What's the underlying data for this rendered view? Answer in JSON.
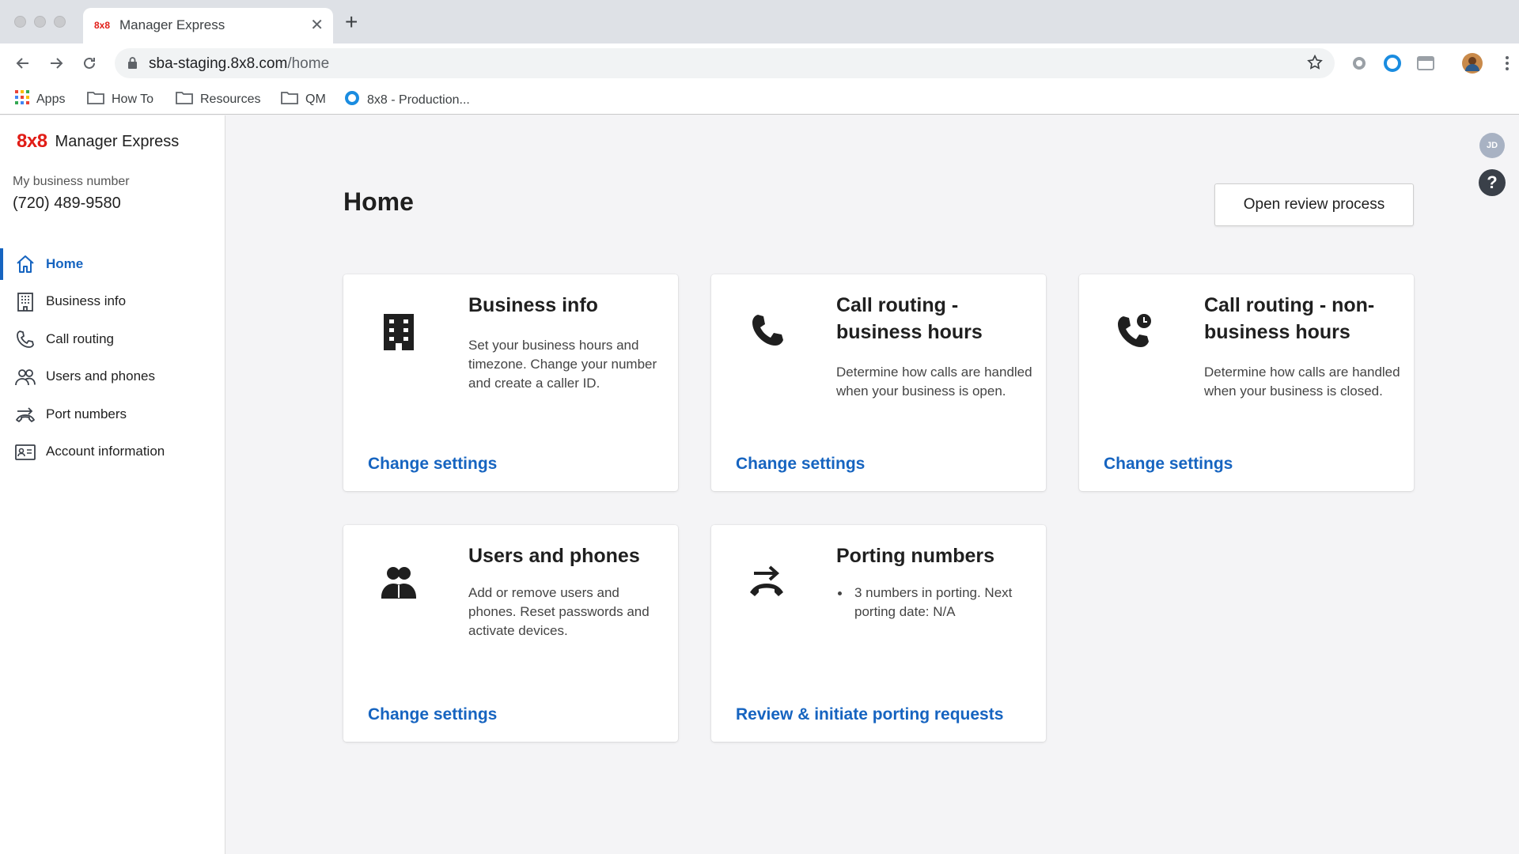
{
  "browser": {
    "tab_title": "Manager Express",
    "tab_favicon": "8x8",
    "url_host": "sba-staging.8x8.com",
    "url_path": "/home",
    "bookmarks": [
      {
        "label": "Apps",
        "icon": "apps-grid-icon"
      },
      {
        "label": "How To",
        "icon": "folder-icon"
      },
      {
        "label": "Resources",
        "icon": "folder-icon"
      },
      {
        "label": "QM",
        "icon": "folder-icon"
      },
      {
        "label": "8x8 - Production...",
        "icon": "circle-logo-icon"
      }
    ]
  },
  "app": {
    "logo": "8x8",
    "name": "Manager Express",
    "business_number_label": "My business number",
    "business_number": "(720) 489-9580",
    "user_initials": "JD",
    "help_glyph": "?"
  },
  "nav": {
    "items": [
      {
        "label": "Home",
        "icon": "home-icon",
        "active": true
      },
      {
        "label": "Business info",
        "icon": "building-icon"
      },
      {
        "label": "Call routing",
        "icon": "phone-icon"
      },
      {
        "label": "Users and phones",
        "icon": "users-icon"
      },
      {
        "label": "Port numbers",
        "icon": "port-icon"
      },
      {
        "label": "Account information",
        "icon": "id-card-icon"
      }
    ]
  },
  "main": {
    "title": "Home",
    "review_button": "Open review process",
    "cards": [
      {
        "title": "Business info",
        "description": "Set your business hours and timezone. Change your number and create a caller ID.",
        "link": "Change settings",
        "icon": "building-icon"
      },
      {
        "title": "Call routing - business hours",
        "description": "Determine how calls are handled when your business is open.",
        "link": "Change settings",
        "icon": "phone-icon"
      },
      {
        "title": "Call routing - non-business hours",
        "description": "Determine how calls are handled when your business is closed.",
        "link": "Change settings",
        "icon": "phone-clock-icon"
      },
      {
        "title": "Users and phones",
        "description": "Add or remove users and phones. Reset passwords and activate devices.",
        "link": "Change settings",
        "icon": "users-icon"
      },
      {
        "title": "Porting numbers",
        "bullets": [
          "3 numbers in porting. Next porting date: N/A"
        ],
        "link": "Review & initiate porting requests",
        "icon": "port-icon"
      }
    ]
  },
  "colors": {
    "brand_red": "#e11d17",
    "link_blue": "#1664c0",
    "page_bg": "#f4f4f6"
  }
}
